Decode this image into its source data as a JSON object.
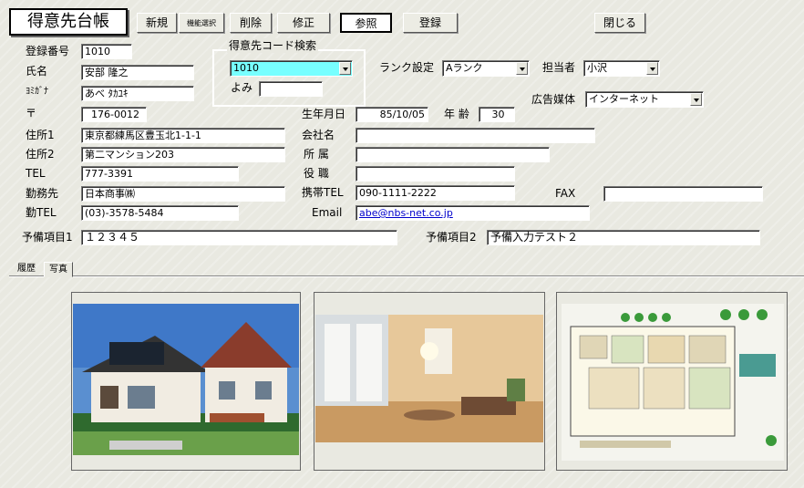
{
  "form": {
    "title": "得意先台帳",
    "toolbar": {
      "new_label": "新規",
      "feature_select_label": "機能選択",
      "delete_label": "削除",
      "edit_label": "修正",
      "view_label": "参照",
      "register_label": "登録",
      "close_label": "閉じる"
    },
    "search": {
      "group_label": "得意先コード検索",
      "code_value": "1010",
      "yomi_label": "よみ",
      "yomi_value": ""
    },
    "fields": {
      "reg_no_label": "登録番号",
      "reg_no": "1010",
      "name_label": "氏名",
      "name": "安部 隆之",
      "kana_label": "ﾖﾐｶﾞﾅ",
      "kana": "あべ ﾀｶﾕｷ",
      "zip_label": "〒",
      "zip": "176-0012",
      "addr1_label": "住所1",
      "addr1": "東京都練馬区豊玉北1-1-1",
      "addr2_label": "住所2",
      "addr2": "第二マンション203",
      "tel_label": "TEL",
      "tel": "777-3391",
      "employer_label": "勤務先",
      "employer": "日本商事㈱",
      "worktel_label": "勤TEL",
      "worktel": "(03)-3578-5484",
      "spare1_label": "予備項目1",
      "spare1": "１２３４５",
      "spare2_label": "予備項目2",
      "spare2": "予備入力テスト２",
      "rank_label": "ランク設定",
      "rank": "Aランク",
      "staff_label": "担当者",
      "staff": "小沢",
      "media_label": "広告媒体",
      "media": "インターネット",
      "birth_label": "生年月日",
      "birth": "85/10/05",
      "age_label": "年 齢",
      "age": "30",
      "company_label": "会社名",
      "company": "",
      "dept_label": "所 属",
      "dept": "",
      "position_label": "役 職",
      "position": "",
      "mobile_label": "携帯TEL",
      "mobile": "090-1111-2222",
      "fax_label": "FAX",
      "fax": "",
      "email_label": "Email",
      "email": "abe@nbs-net.co.jp"
    },
    "tabs": [
      {
        "label": "履歴"
      },
      {
        "label": "写真",
        "active": true
      }
    ]
  }
}
